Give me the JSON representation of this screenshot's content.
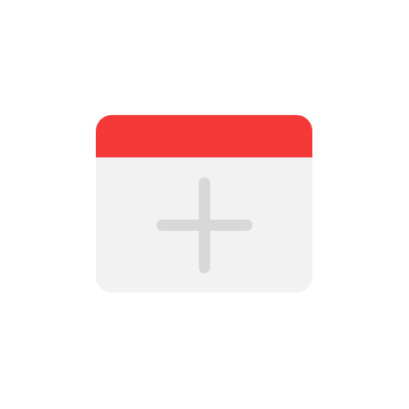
{
  "icon": {
    "name": "add-tab-icon",
    "glyph": "plus-icon",
    "colors": {
      "header": "#f53838",
      "body": "#f2f2f2",
      "plus": "#d8d8d8",
      "background": "#ffffff"
    }
  }
}
